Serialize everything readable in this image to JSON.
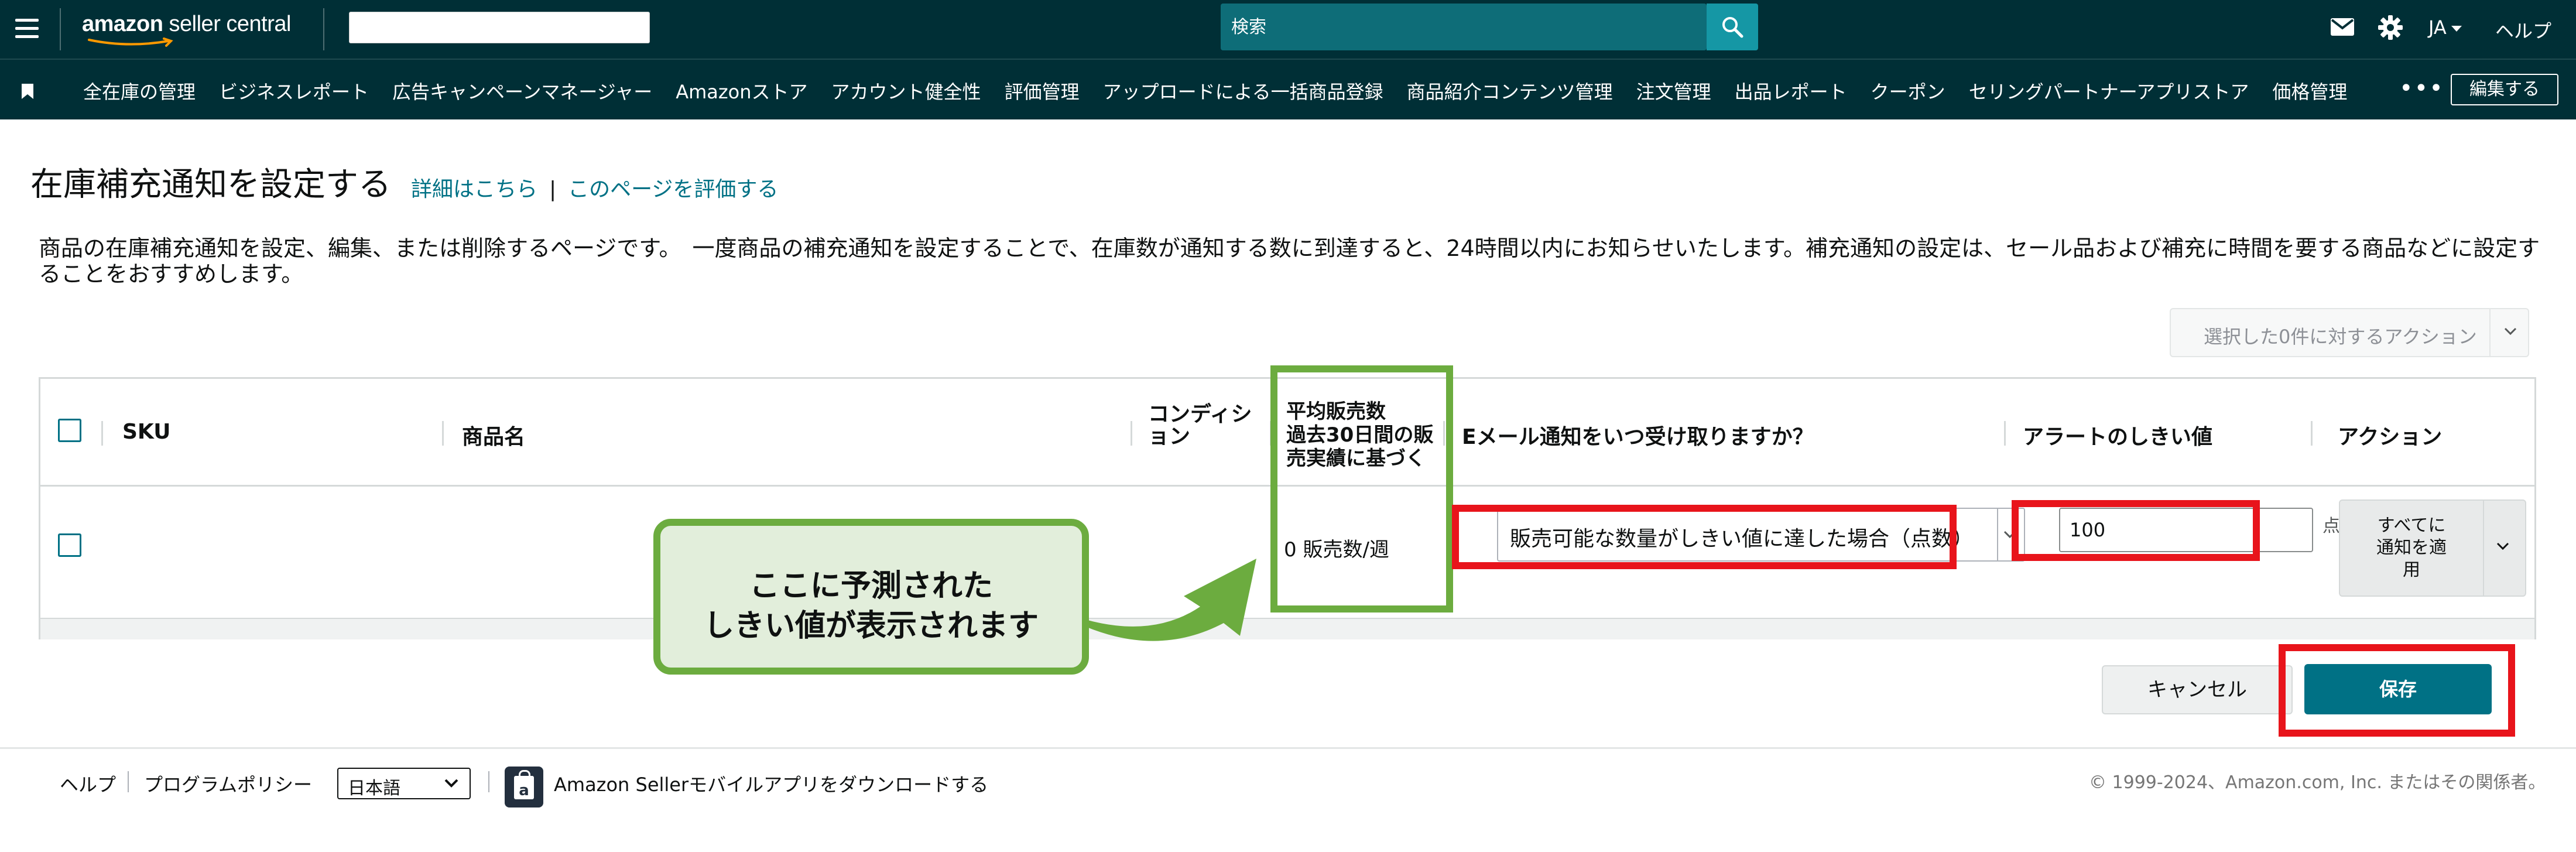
{
  "topbar": {
    "logo_text_bold": "amazon",
    "logo_text": " seller central",
    "search_placeholder": "検索",
    "language": "JA",
    "help": "ヘルプ"
  },
  "nav": {
    "items": [
      "全在庫の管理",
      "ビジネスレポート",
      "広告キャンペーンマネージャー",
      "Amazonストア",
      "アカウント健全性",
      "評価管理",
      "アップロードによる一括商品登録",
      "商品紹介コンテンツ管理",
      "注文管理",
      "出品レポート",
      "クーポン",
      "セリングパートナーアプリストア",
      "価格管理"
    ],
    "more": "•••",
    "edit": "編集する"
  },
  "page": {
    "title": "在庫補充通知を設定する",
    "link_details": "詳細はこちら",
    "link_separator": "|",
    "link_rate": "このページを評価する",
    "description": "商品の在庫補充通知を設定、編集、または削除するページです。　一度商品の補充通知を設定することで、在庫数が通知する数に到達すると、24時間以内にお知らせいたします。補充通知の設定は、セール品および補充に時間を要する商品などに設定することをおすすめします。",
    "bulk_action": "選択した0件に対するアクション"
  },
  "table": {
    "headers": {
      "sku": "SKU",
      "product": "商品名",
      "condition_1": "コンディシ",
      "condition_2": "ョン",
      "avg_sales_1": "平均販売数",
      "avg_sales_2": "過去30日間の販",
      "avg_sales_3": "売実績に基づく",
      "email_when": "Eメール通知をいつ受け取りますか？",
      "threshold": "アラートのしきい値",
      "action": "アクション"
    },
    "row": {
      "avg_sales": "0 販売数/週",
      "notify_condition": "販売可能な数量がしきい値に達した場合（点数）",
      "threshold_value": "100",
      "unit": "点",
      "apply_all_1": "すべてに",
      "apply_all_2": "通知を適",
      "apply_all_3": "用"
    }
  },
  "buttons": {
    "cancel": "キャンセル",
    "save": "保存"
  },
  "annotation": {
    "line1": "ここに予測された",
    "line2": "しきい値が表示されます",
    "green": "#6cac3f",
    "red": "#e8141b"
  },
  "footer": {
    "help": "ヘルプ",
    "policy": "プログラムポリシー",
    "language": "日本語",
    "app": "Amazon Sellerモバイルアプリをダウンロードする",
    "copyright": "© 1999-2024、Amazon.com, Inc. またはその関係者。"
  },
  "colors": {
    "header_bg": "#002f36",
    "search_bg": "#0e6d78",
    "search_button": "#1597a5",
    "link": "#007185",
    "save_button": "#007185"
  }
}
